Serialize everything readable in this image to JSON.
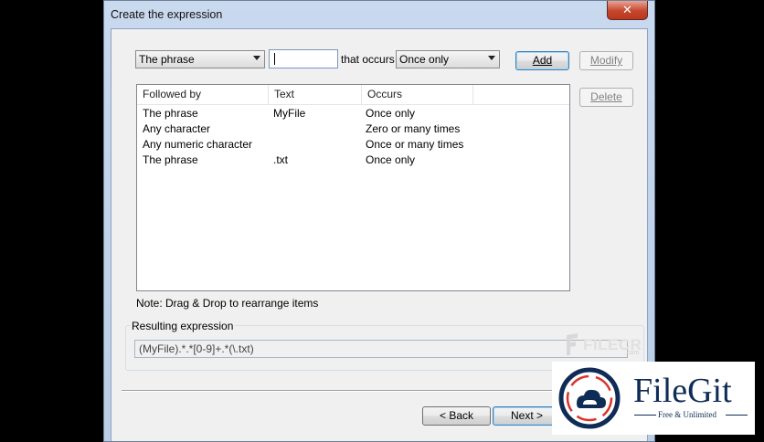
{
  "window": {
    "title": "Create the expression",
    "close_glyph": "✕"
  },
  "builder": {
    "phrase_type": "The phrase",
    "text_value": "",
    "that_occurs_label": "that occurs",
    "occurrence": "Once only",
    "add_label": "Add",
    "modify_label": "Modify",
    "delete_label": "Delete"
  },
  "list": {
    "columns": [
      "Followed by",
      "Text",
      "Occurs"
    ],
    "rows": [
      {
        "followed_by": "The phrase",
        "text": "MyFile",
        "occurs": "Once only"
      },
      {
        "followed_by": "Any character",
        "text": "",
        "occurs": "Zero or many times"
      },
      {
        "followed_by": "Any numeric character",
        "text": "",
        "occurs": "Once or many times"
      },
      {
        "followed_by": "The phrase",
        "text": ".txt",
        "occurs": "Once only"
      }
    ]
  },
  "note": "Note: Drag & Drop to rearrange items",
  "result": {
    "label": "Resulting expression",
    "value": "(MyFile).*.*[0-9]+.*(\\.txt)"
  },
  "nav": {
    "back_label": "< Back",
    "next_label": "Next >"
  },
  "watermarks": {
    "filecr": {
      "text": "FILECR",
      "sub": ".com"
    },
    "filegit": {
      "name": "FileGit",
      "tagline": "Free & Unlimited",
      "brand_color": "#0e2c55",
      "accent_color": "#d9342b"
    }
  }
}
